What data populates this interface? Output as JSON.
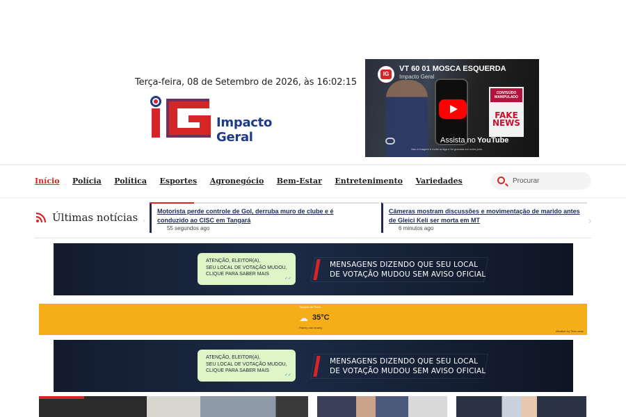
{
  "header": {
    "date_time": "Terça-feira, 08 de Setembro de 2026, às 16:02:15",
    "logo_text": "Impacto Geral",
    "logo_initials": "IG"
  },
  "video": {
    "title": "VT 60 01 MOSCA ESQUERDA",
    "channel": "Impacto Geral",
    "watch_on": "Assista no",
    "youtube": "YouTube",
    "panel_top": "CONTEÚDO MANIPULADO",
    "panel_big": "FAKE NEWS",
    "caption": "Nas a imagem é muito antiga e foi gravada em outro país."
  },
  "nav": {
    "items": [
      {
        "label": "Início",
        "active": true
      },
      {
        "label": "Polícia"
      },
      {
        "label": "Política"
      },
      {
        "label": "Esportes"
      },
      {
        "label": "Agronegócio"
      },
      {
        "label": "Bem-Estar"
      },
      {
        "label": "Entretenimento"
      },
      {
        "label": "Variedades"
      }
    ],
    "search_placeholder": "Procurar"
  },
  "latest": {
    "title": "Últimas notícias",
    "items": [
      {
        "headline": "Motorista perde controle de Gol, derruba muro de clube e é conduzido ao CISC em Tangará",
        "time": "55 segundos ago"
      },
      {
        "headline": "Câmeras mostram discussões e movimentação de marido antes de Gleici Keli ser morta em MT",
        "time": "6 minutos ago"
      }
    ]
  },
  "ads": {
    "bubble_lines": [
      "ATENÇÃO, ELEITOR(A),",
      "SEU LOCAL DE VOTAÇÃO MUDOU,",
      "CLIQUE PARA SABER MAIS"
    ],
    "message_lines": [
      "MENSAGENS DIZENDO QUE SEU LOCAL",
      "DE VOTAÇÃO MUDOU SEM AVISO OFICIAL"
    ],
    "bubble_time": "10:45"
  },
  "weather": {
    "location": "Tangará da Serra",
    "temperature": "35°C",
    "description": "Patchy rain nearby",
    "credit": "Weather by Tiles.news"
  },
  "colors": {
    "accent": "#d42626",
    "navy": "#1e2a55",
    "weather_bg": "#f6ae18"
  }
}
